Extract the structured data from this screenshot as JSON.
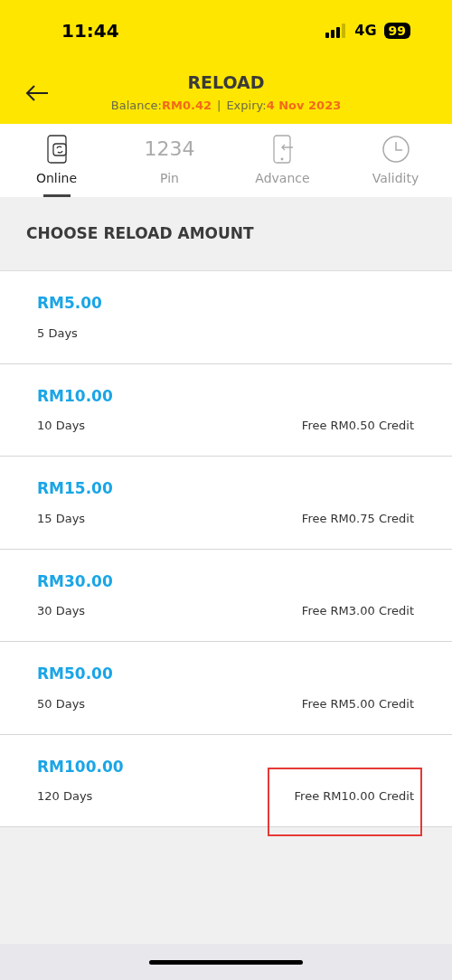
{
  "status_bar": {
    "time": "11:44",
    "network": "4G",
    "battery": "99"
  },
  "header": {
    "title": "RELOAD",
    "balance_label": "Balance:",
    "balance": "RM0.42",
    "expiry_label": "Expiry:",
    "expiry": "4 Nov 2023",
    "separator": "|"
  },
  "tabs": [
    {
      "label": "Online",
      "kind": "phone-sync",
      "selected": true
    },
    {
      "label": "Pin",
      "kind": "text",
      "icon_text": "1234",
      "selected": false
    },
    {
      "label": "Advance",
      "kind": "phone-in",
      "selected": false
    },
    {
      "label": "Validity",
      "kind": "clock",
      "selected": false
    }
  ],
  "section_title": "CHOOSE RELOAD AMOUNT",
  "amounts": [
    {
      "price": "RM5.00",
      "validity": "5 Days",
      "highlighted": false
    },
    {
      "price": "RM10.00",
      "validity": "10 Days",
      "bonus": "Free RM0.50 Credit",
      "highlighted": false
    },
    {
      "price": "RM15.00",
      "validity": "15 Days",
      "bonus": "Free RM0.75 Credit",
      "highlighted": false
    },
    {
      "price": "RM30.00",
      "validity": "30 Days",
      "bonus": "Free RM3.00 Credit",
      "highlighted": false
    },
    {
      "price": "RM50.00",
      "validity": "50 Days",
      "bonus": "Free RM5.00 Credit",
      "highlighted": false
    },
    {
      "price": "RM100.00",
      "validity": "120 Days",
      "bonus": "Free RM10.00 Credit",
      "highlighted": true
    }
  ]
}
